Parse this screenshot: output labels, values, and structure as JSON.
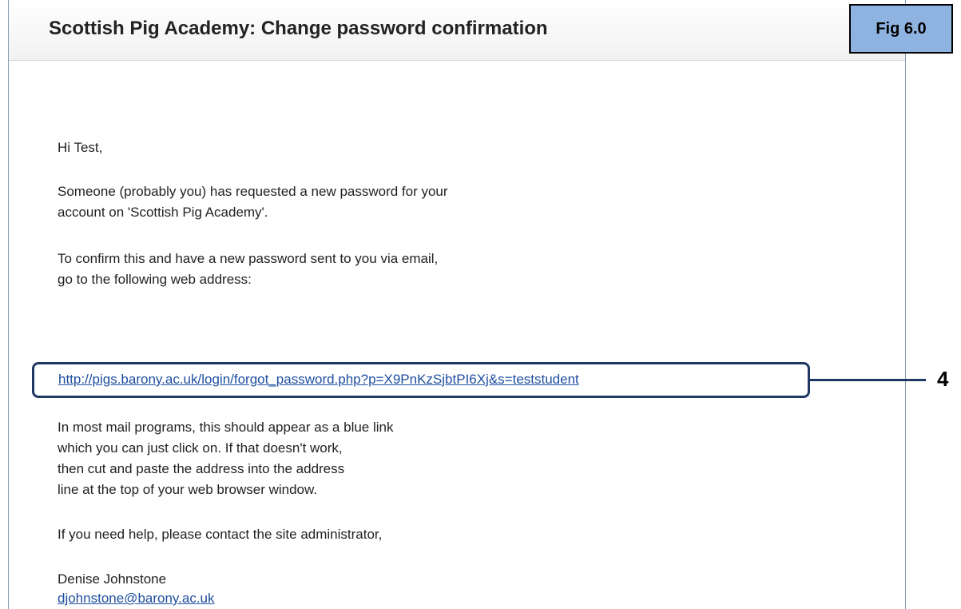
{
  "email": {
    "subject": "Scottish Pig Academy: Change password confirmation",
    "greeting": "Hi Test,",
    "para1_line1": "Someone (probably you) has requested a new password for your",
    "para1_line2": "account on 'Scottish Pig Academy'.",
    "para2_line1": "To confirm this and have a new password sent to you via email,",
    "para2_line2": "go to the following web address:",
    "confirm_link": "http://pigs.barony.ac.uk/login/forgot_password.php?p=X9PnKzSjbtPI6Xj&s=teststudent",
    "para3_line1": "In most mail programs, this should appear as a blue link",
    "para3_line2": "which you can just click on.  If that doesn't work,",
    "para3_line3": "then cut and paste the address into the address",
    "para3_line4": "line at the top of your web browser window.",
    "para4": "If you need help, please contact the site administrator,",
    "signature_name": "Denise Johnstone",
    "signature_email": "djohnstone@barony.ac.uk"
  },
  "annotations": {
    "fig_label": "Fig 6.0",
    "callout_number": "4",
    "callout_color": "#1f3864",
    "fig_label_bg": "#8eb3e0"
  },
  "colors": {
    "link": "#1f4fa0",
    "text": "#222222",
    "panel_border": "#7f9db9"
  }
}
